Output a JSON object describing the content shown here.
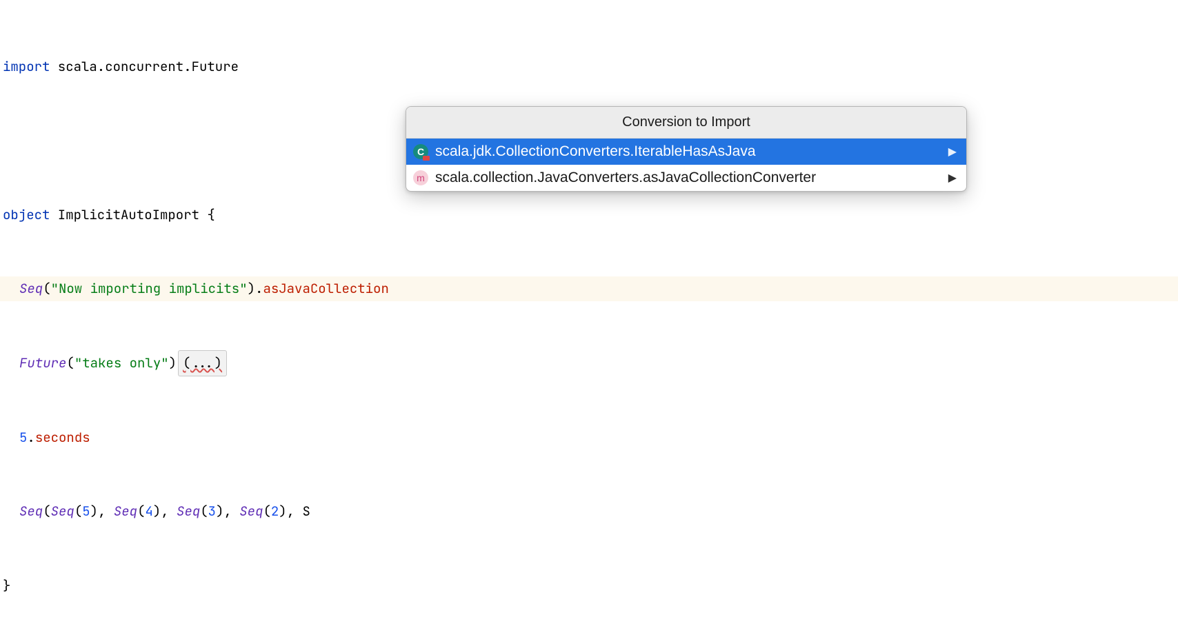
{
  "code": {
    "line1": {
      "kw": "import",
      "path": " scala.concurrent.Future"
    },
    "line2": "",
    "line3": {
      "kw": "object",
      "name": " ImplicitAutoImport ",
      "brace": "{"
    },
    "line4": {
      "seq": "Seq",
      "open": "(",
      "str": "\"Now importing implicits\"",
      "close": ")",
      "dot": ".",
      "call": "asJavaCollection"
    },
    "line5": {
      "future": "Future",
      "open": "(",
      "str": "\"takes only\"",
      "close": ")",
      "err": "(...)"
    },
    "line6": {
      "num": "5",
      "dot": ".",
      "member": "seconds"
    },
    "line7": {
      "seq": "Seq",
      "open": "(",
      "inner": "Seq(5), Seq(4), Seq(3), Seq(2), S",
      "n1": "5",
      "n2": "4",
      "n3": "3",
      "n4": "2"
    },
    "line8": {
      "brace": "}"
    }
  },
  "popup": {
    "title": "Conversion to Import",
    "items": [
      {
        "icon": "C",
        "iconType": "class",
        "label": "scala.jdk.CollectionConverters.IterableHasAsJava",
        "selected": true,
        "hasSubmenu": true
      },
      {
        "icon": "m",
        "iconType": "method",
        "label": "scala.collection.JavaConverters.asJavaCollectionConverter",
        "selected": false,
        "hasSubmenu": true
      }
    ],
    "arrow": "▶"
  }
}
